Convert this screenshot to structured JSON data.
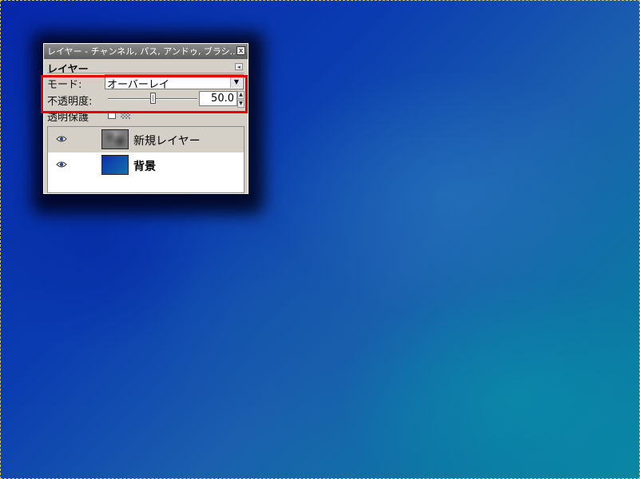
{
  "window": {
    "title": "レイヤー - チャンネル, パス, アンドゥ, ブラシ...",
    "close_label": "x",
    "menu_arrow": "◂"
  },
  "dock": {
    "title": "レイヤー",
    "mode": {
      "label": "モード:",
      "value": "オーバーレイ",
      "arrow": "▼"
    },
    "opacity": {
      "label": "不透明度:",
      "value": "50.0",
      "up": "▲",
      "down": "▼",
      "level_percent": 50
    },
    "lock": {
      "label": "透明保護",
      "checked": false
    }
  },
  "layers": [
    {
      "name": "新規レイヤー",
      "visible": true,
      "selected": true,
      "thumbnail": "noise"
    },
    {
      "name": "背景",
      "visible": true,
      "selected": false,
      "thumbnail": "blue-gradient"
    }
  ],
  "colors": {
    "highlight": "#e00000",
    "selection_border": "#e6d86a"
  }
}
